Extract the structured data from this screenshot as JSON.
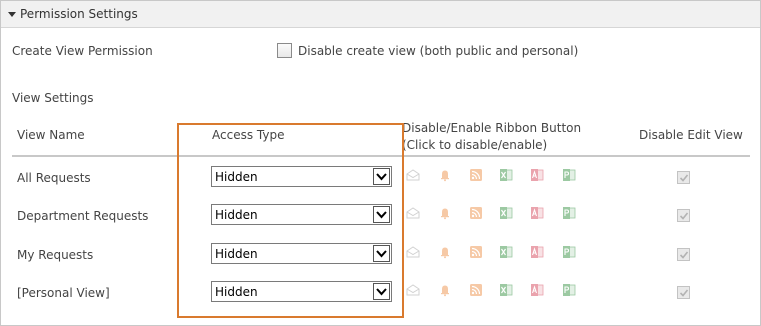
{
  "panel": {
    "title": "Permission Settings"
  },
  "create_view": {
    "label": "Create View Permission",
    "checkbox_label": "Disable create view (both public and personal)",
    "checked": false
  },
  "view_settings": {
    "heading": "View Settings",
    "columns": {
      "view_name": "View Name",
      "access_type": "Access Type",
      "ribbon": "Disable/Enable Ribbon Button (Click to disable/enable)",
      "edit": "Disable Edit View"
    },
    "ribbon_icons": [
      "mail-icon",
      "alert-bell-icon",
      "rss-icon",
      "excel-icon",
      "access-icon",
      "project-icon"
    ],
    "rows": [
      {
        "name": "All Requests",
        "access": "Hidden",
        "disable_edit": true
      },
      {
        "name": "Department Requests",
        "access": "Hidden",
        "disable_edit": true
      },
      {
        "name": "My Requests",
        "access": "Hidden",
        "disable_edit": true
      },
      {
        "name": "[Personal View]",
        "access": "Hidden",
        "disable_edit": true
      }
    ]
  },
  "colors": {
    "highlight": "#d97a2e",
    "header_bg": "#f1f1f1",
    "icon_orange": "#f6c9a6",
    "icon_green": "#9cc9a2",
    "icon_pink": "#eaa3ad"
  }
}
